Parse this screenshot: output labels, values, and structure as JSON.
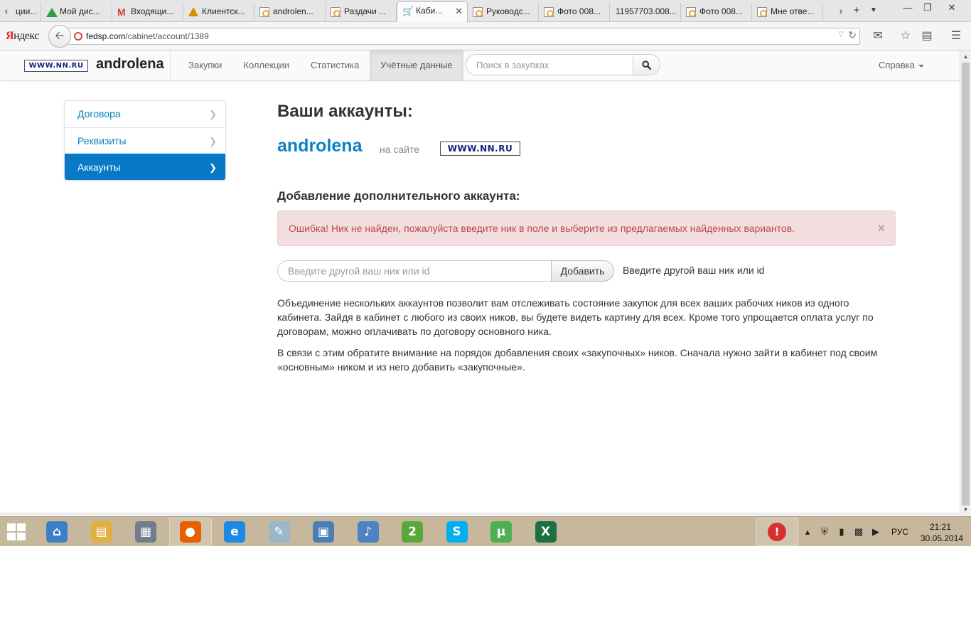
{
  "browser": {
    "tabs": [
      {
        "label": "ции...",
        "icon": "document-icon"
      },
      {
        "label": "Мой дис...",
        "icon": "drive-icon"
      },
      {
        "label": "Входящи...",
        "icon": "gmail-icon"
      },
      {
        "label": "Клиентск...",
        "icon": "warning-icon"
      },
      {
        "label": "androlen...",
        "icon": "document-icon"
      },
      {
        "label": "Раздачи ...",
        "icon": "document-icon"
      },
      {
        "label": "Каби...",
        "icon": "basket-icon",
        "active": true
      },
      {
        "label": "Руководс...",
        "icon": "document-icon"
      },
      {
        "label": "Фото 008...",
        "icon": "document-icon"
      },
      {
        "label": "11957703.008...",
        "icon": "none"
      },
      {
        "label": "Фото 008...",
        "icon": "document-icon"
      },
      {
        "label": "Мне отве...",
        "icon": "document-icon"
      }
    ],
    "new_tab_symbol": "+",
    "menu_button": "Яндекс",
    "url": {
      "host": "fedsp.com",
      "path": "/cabinet/account/1389"
    }
  },
  "site": {
    "logo_text": "WWW.NN.RU",
    "brand": "androlena",
    "menu": [
      "Закупки",
      "Коллекции",
      "Статистика",
      "Учётные данные"
    ],
    "active_menu": "Учётные данные",
    "search_placeholder": "Поиск в закупках",
    "help": "Справка"
  },
  "sidebar": {
    "items": [
      {
        "label": "Договора"
      },
      {
        "label": "Реквизиты"
      },
      {
        "label": "Аккаунты",
        "active": true
      }
    ]
  },
  "main": {
    "title": "Ваши аккаунты:",
    "account_nick": "androlena",
    "on_site": "на сайте",
    "site_logo": "WWW.NN.RU",
    "add_title": "Добавление дополнительного аккаунта:",
    "alert": "Ошибка! Ник не найден, пожалуйста введите ник в поле и выберите из предлагаемых найденных вариантов.",
    "alert_close": "×",
    "input_placeholder": "Введите другой ваш ник или id",
    "add_button": "Добавить",
    "input_hint": "Введите другой ваш ник или id",
    "paragraph_1": "Объединение нескольких аккаунтов позволит вам отслеживать состояние закупок для всех ваших рабочих ников из одного кабинета. Зайдя в кабинет с любого из своих ников, вы будете видеть картину для всех. Кроме того упрощается оплата услуг по договорам, можно оплачивать по договору основного ника.",
    "paragraph_2": "В связи с этим обратите внимание на порядок добавления своих «закупочных» ников. Сначала нужно зайти в кабинет под своим «основным» ником и из него добавить «закупочные»."
  },
  "taskbar": {
    "apps": [
      {
        "name": "home",
        "color": "#3d7ec9",
        "glyph": "⌂"
      },
      {
        "name": "file-explorer",
        "color": "#e0b040",
        "glyph": "▤"
      },
      {
        "name": "calculator",
        "color": "#6f7d8c",
        "glyph": "▦"
      },
      {
        "name": "firefox",
        "color": "#e66000",
        "glyph": "●",
        "running": true
      },
      {
        "name": "internet-explorer",
        "color": "#1e88e5",
        "glyph": "e"
      },
      {
        "name": "paint",
        "color": "#9bb7c9",
        "glyph": "✎"
      },
      {
        "name": "remote-desktop",
        "color": "#4a7fb5",
        "glyph": "▣"
      },
      {
        "name": "volume-app",
        "color": "#4b83c4",
        "glyph": "♪"
      },
      {
        "name": "maps-2gis",
        "color": "#5aa83c",
        "glyph": "2"
      },
      {
        "name": "skype",
        "color": "#00aff0",
        "glyph": "S"
      },
      {
        "name": "utorrent",
        "color": "#4caf50",
        "glyph": "µ"
      },
      {
        "name": "excel",
        "color": "#1d7044",
        "glyph": "X"
      }
    ],
    "language": "РУС",
    "time": "21:21",
    "date": "30.05.2014"
  }
}
